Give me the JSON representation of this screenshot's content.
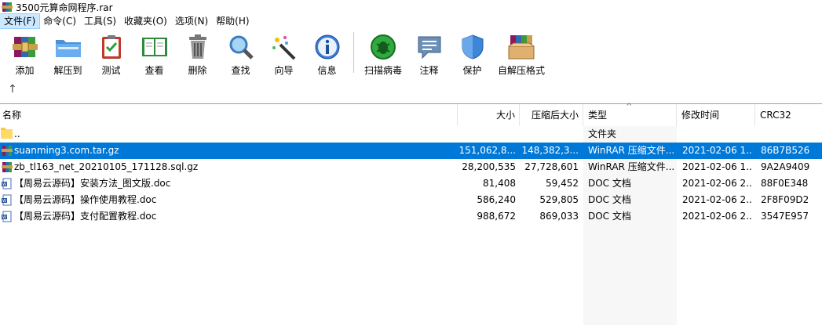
{
  "window": {
    "title": "3500元算命网程序.rar"
  },
  "menu": [
    "文件(F)",
    "命令(C)",
    "工具(S)",
    "收藏夹(O)",
    "选项(N)",
    "帮助(H)"
  ],
  "toolbar": {
    "add": "添加",
    "extract": "解压到",
    "test": "测试",
    "view": "查看",
    "delete": "删除",
    "find": "查找",
    "wizard": "向导",
    "info": "信息",
    "scan": "扫描病毒",
    "comment": "注释",
    "protect": "保护",
    "sfx": "自解压格式"
  },
  "nav": {
    "up_icon": "up-arrow-icon"
  },
  "columns": {
    "name": "名称",
    "size": "大小",
    "packed": "压缩后大小",
    "type": "类型",
    "modified": "修改时间",
    "crc": "CRC32"
  },
  "files": [
    {
      "name": "..",
      "size": "",
      "packed": "",
      "type": "文件夹",
      "modified": "",
      "crc": "",
      "icon": "folder-icon"
    },
    {
      "name": "suanming3.com.tar.gz",
      "size": "151,062,8...",
      "packed": "148,382,3...",
      "type": "WinRAR 压缩文件...",
      "modified": "2021-02-06 1...",
      "crc": "86B7B526",
      "icon": "rar-archive-icon"
    },
    {
      "name": "zb_tl163_net_20210105_171128.sql.gz",
      "size": "28,200,535",
      "packed": "27,728,601",
      "type": "WinRAR 压缩文件...",
      "modified": "2021-02-06 1...",
      "crc": "9A2A9409",
      "icon": "rar-archive-icon"
    },
    {
      "name": "【周易云源码】安装方法_图文版.doc",
      "size": "81,408",
      "packed": "59,452",
      "type": "DOC 文档",
      "modified": "2021-02-06 2...",
      "crc": "88F0E348",
      "icon": "doc-icon"
    },
    {
      "name": "【周易云源码】操作使用教程.doc",
      "size": "586,240",
      "packed": "529,805",
      "type": "DOC 文档",
      "modified": "2021-02-06 2...",
      "crc": "2F8F09D2",
      "icon": "doc-icon"
    },
    {
      "name": "【周易云源码】支付配置教程.doc",
      "size": "988,672",
      "packed": "869,033",
      "type": "DOC 文档",
      "modified": "2021-02-06 2...",
      "crc": "3547E957",
      "icon": "doc-icon"
    }
  ],
  "colors": {
    "selection": "#0078d7",
    "menu_highlight": "#cce8ff"
  }
}
